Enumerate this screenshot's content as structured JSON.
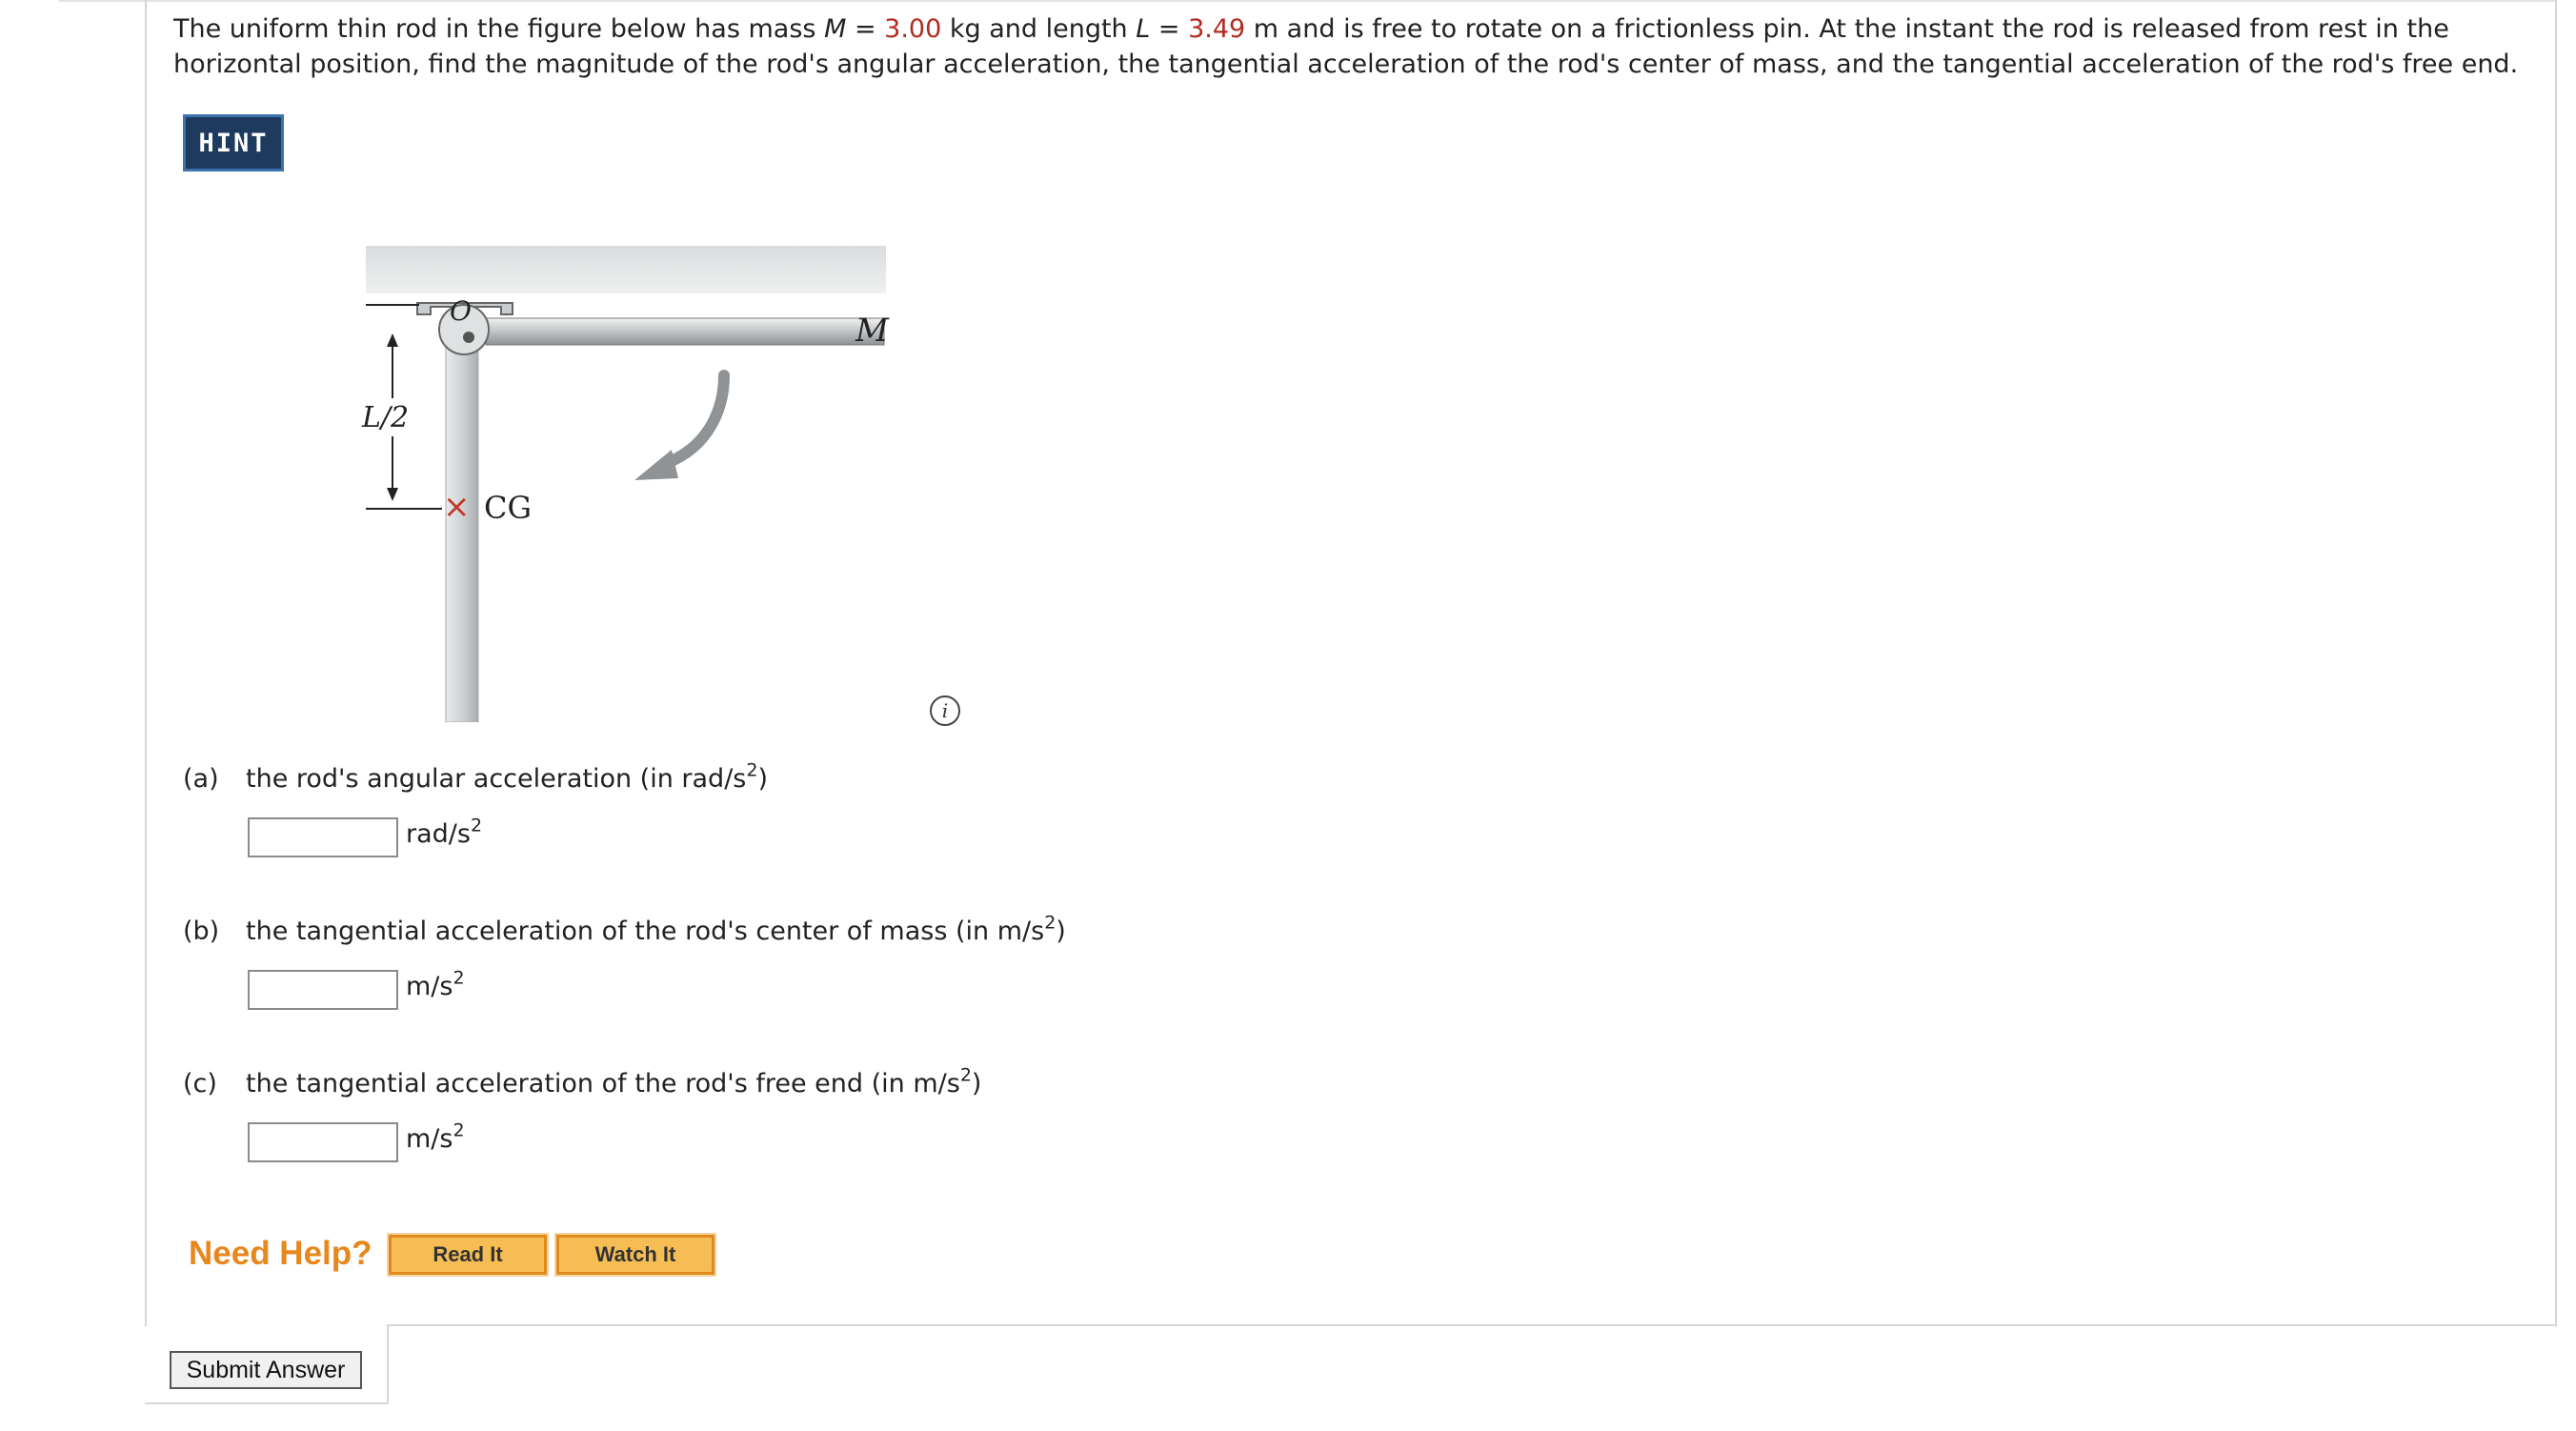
{
  "problem": {
    "text_before_mass": "The uniform thin rod in the figure below has mass ",
    "mass_symbol": "M",
    "eq1": " = ",
    "mass_value": "3.00",
    "text_after_mass": " kg and length ",
    "length_symbol": "L",
    "eq2": " = ",
    "length_value": "3.49",
    "text_after_length": " m and is free to rotate on a frictionless pin. At the instant the rod is released from rest in the horizontal position, find the magnitude of the rod's angular acceleration, the tangential acceleration of the rod's center of mass, and the tangential acceleration of the rod's free end."
  },
  "hint_label": "HINT",
  "figure": {
    "pivot_label": "O",
    "mass_label": "M",
    "half_length_label": "L/2",
    "cg_mark": "×",
    "cg_label": "CG"
  },
  "info_icon_label": "i",
  "questions": [
    {
      "letter": "(a)",
      "text": "the rod's angular acceleration (in rad/s",
      "text_end": ")",
      "unit": "rad/s",
      "value": ""
    },
    {
      "letter": "(b)",
      "text": "the tangential acceleration of the rod's center of mass (in m/s",
      "text_end": ")",
      "unit": "m/s",
      "value": ""
    },
    {
      "letter": "(c)",
      "text": "the tangential acceleration of the rod's free end (in m/s",
      "text_end": ")",
      "unit": "m/s",
      "value": ""
    }
  ],
  "superscript": "2",
  "need_help": "Need Help?",
  "read_it": "Read It",
  "watch_it": "Watch It",
  "submit": "Submit Answer",
  "colors": {
    "highlight": "#b32b20",
    "hint_bg": "#1e3a5f",
    "help_orange": "#e8871e",
    "help_button": "#f7bd55"
  }
}
